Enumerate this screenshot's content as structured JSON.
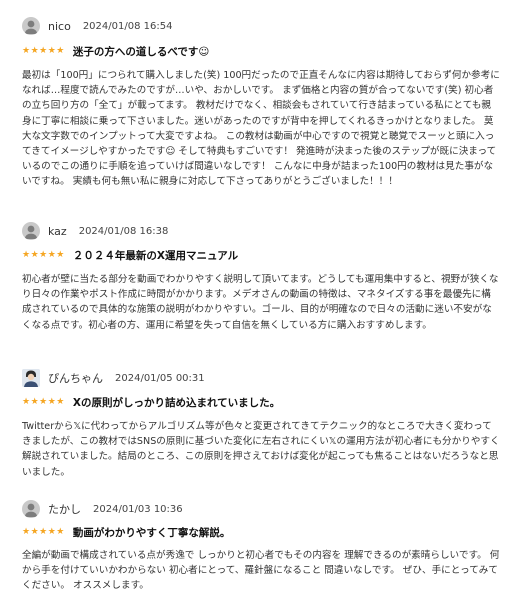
{
  "reviews": [
    {
      "user": "nico",
      "date": "2024/01/08 16:54",
      "stars": "★★★★★",
      "title": "迷子の方への道しるべです☺",
      "body": "最初は「100円」につられて購入しました(笑) 100円だったので正直そんなに内容は期待しておらず何か参考になれば…程度で読んでみたのですが…いや、おかしいです。 まず価格と内容の質が合ってないです(笑) 初心者の立ち回り方の「全て」が載ってます。 教材だけでなく、相談会もされていて行き詰まっている私にとても親身に丁寧に相談に乗って下さいました。迷いがあったのですが背中を押してくれるきっかけとなりました。 莫大な文字数でのインプットって大変ですよね。 この教材は動画が中心ですので視覚と聴覚でスーッと頭に入ってきてイメージしやすかったです☺ そして特典もすごいです！ 発進時が決まった後のステップが既に決まっているのでこの通りに手順を追っていけば間違いなしです！ こんなに中身が詰まった100円の教材は見た事がないですね。 実績も何も無い私に親身に対応して下さってありがとうございました！！！"
    },
    {
      "user": "kaz",
      "date": "2024/01/08 16:38",
      "stars": "★★★★★",
      "title": "２０２４年最新のX運用マニュアル",
      "body": "初心者が壁に当たる部分を動画でわかりやすく説明して頂いてます。どうしても運用集中すると、視野が狭くなり日々の作業やポスト作成に時間がかかります。メデオさんの動画の特徴は、マネタイズする事を最優先に構成されているので具体的な施策の説明がわかりやすい。ゴール、目的が明確なので日々の活動に迷い不安がなくなる点です。初心者の方、運用に希望を失って自信を無くしている方に購入おすすめします。"
    },
    {
      "user": "ぴんちゃん",
      "date": "2024/01/05 00:31",
      "stars": "★★★★★",
      "title": "Xの原則がしっかり詰め込まれていました。",
      "body": "Twitterから𝕏に代わってからアルゴリズム等が色々と変更されてきてテクニック的なところで大きく変わってきましたが、この教材ではSNSの原則に基づいた変化に左右されにくい𝕏の運用方法が初心者にも分かりやすく解説されていました。結局のところ、この原則を押さえておけば変化が起こっても焦ることはないだろうなと思いました。"
    },
    {
      "user": "たかし",
      "date": "2024/01/03 10:36",
      "stars": "★★★★★",
      "title": "動画がわかりやすく丁寧な解説。",
      "body": "全編が動画で構成されている点が秀逸で しっかりと初心者でもその内容を 理解できるのが素晴らしいです。 何から手を付けていいかわからない 初心者にとって、羅針盤になること 間違いなしです。 ぜひ、手にとってみてください。 オススメします。"
    }
  ]
}
